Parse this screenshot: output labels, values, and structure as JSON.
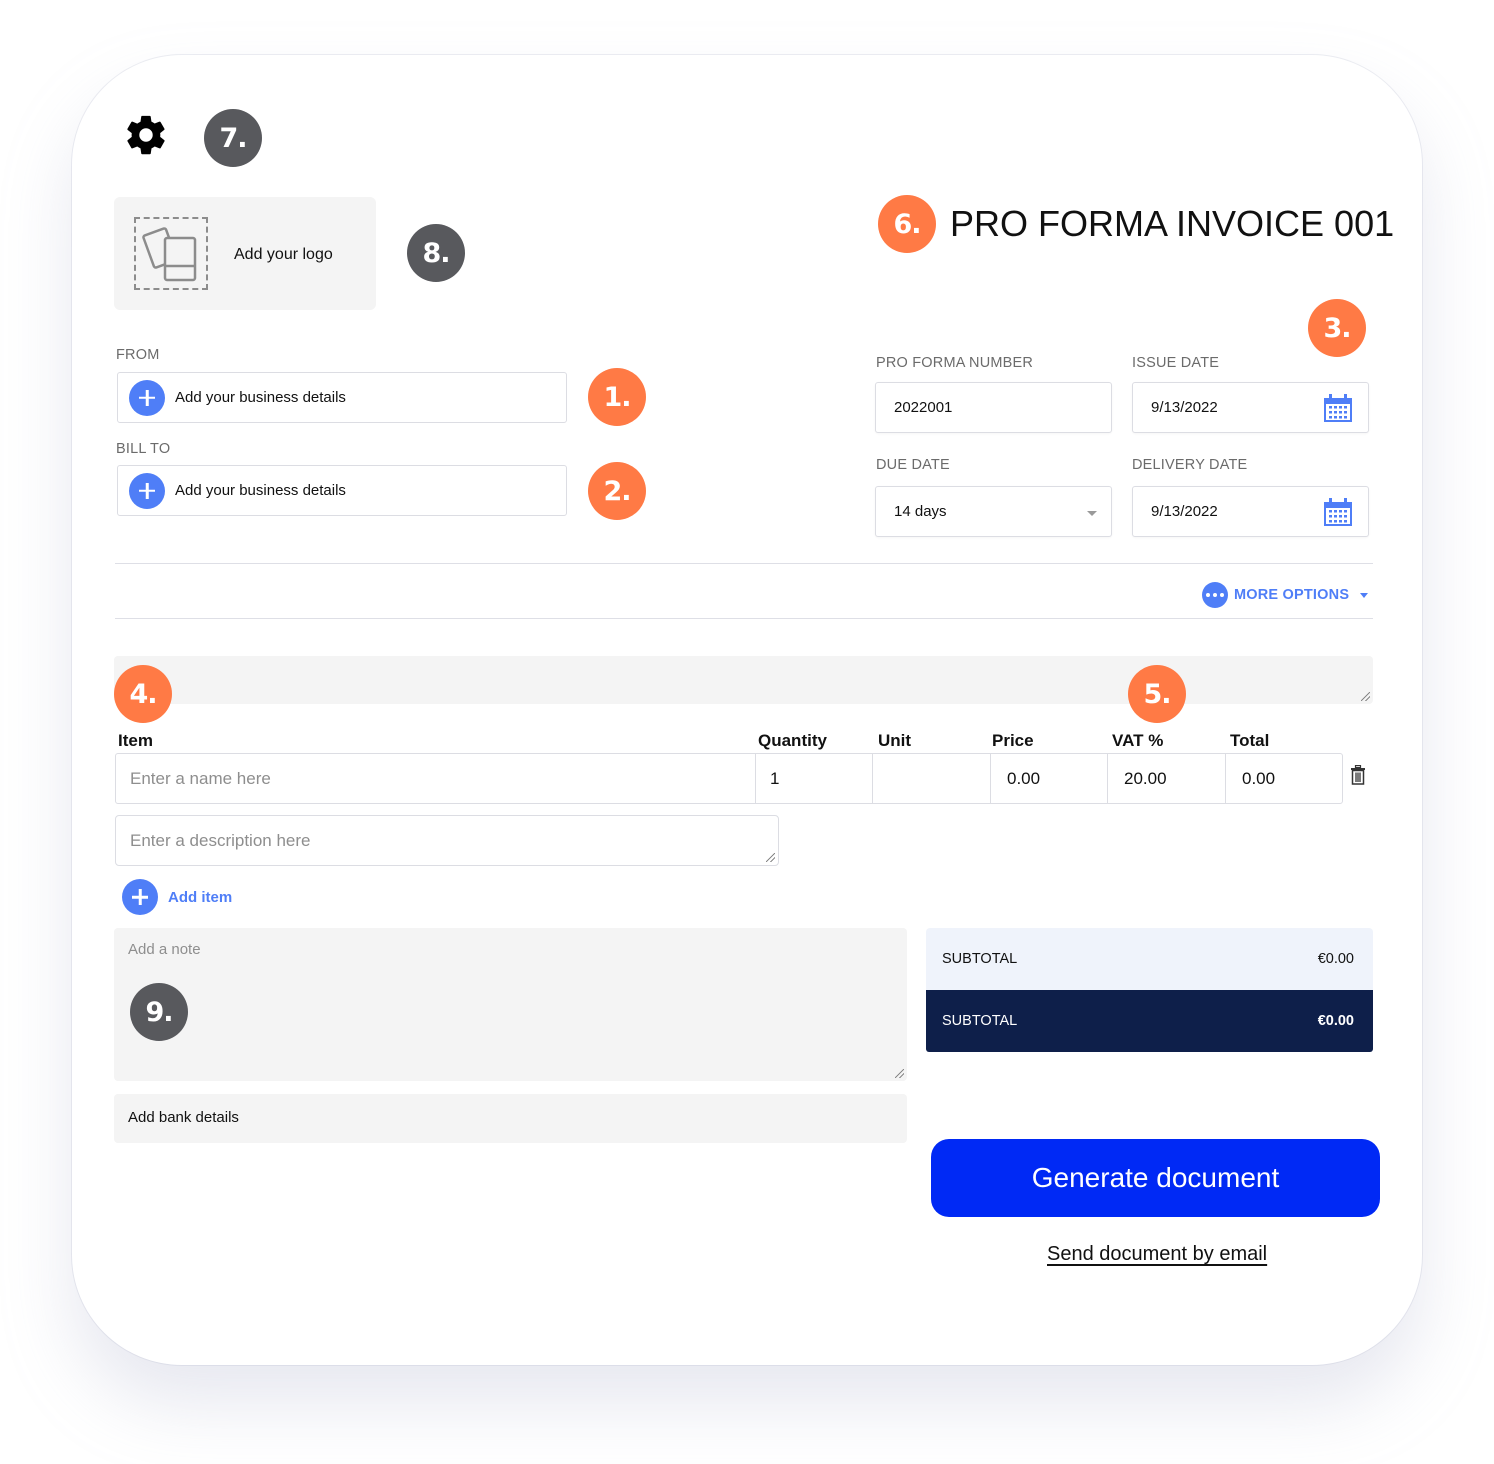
{
  "colors": {
    "accent_blue": "#4f7ef7",
    "primary_button": "#0029f5",
    "badge_orange": "#ff7a45",
    "badge_grey": "#58595d",
    "total_dark": "#0e1f4a",
    "subtotal_light": "#eff3fb"
  },
  "badges": {
    "b1": "1.",
    "b2": "2.",
    "b3": "3.",
    "b4": "4.",
    "b5": "5.",
    "b6": "6.",
    "b7": "7.",
    "b8": "8.",
    "b9": "9."
  },
  "header": {
    "settings_icon": "gear-icon",
    "logo_label": "Add your logo",
    "logo_icon": "image-placeholder-icon",
    "title": "PRO FORMA INVOICE 001"
  },
  "parties": {
    "from_label": "FROM",
    "from_button": "Add your business details",
    "bill_to_label": "BILL TO",
    "bill_to_button": "Add your business details"
  },
  "meta": {
    "number_label": "PRO FORMA NUMBER",
    "number_value": "2022001",
    "issue_date_label": "ISSUE DATE",
    "issue_date_value": "9/13/2022",
    "due_date_label": "DUE DATE",
    "due_date_value": "14 days",
    "delivery_date_label": "DELIVERY DATE",
    "delivery_date_value": "9/13/2022",
    "calendar_icon": "calendar-icon"
  },
  "more_options": {
    "label": "MORE OPTIONS"
  },
  "items": {
    "columns": [
      "Item",
      "Quantity",
      "Unit",
      "Price",
      "VAT %",
      "Total"
    ],
    "row": {
      "name_placeholder": "Enter a name here",
      "quantity": "1",
      "unit": "",
      "price": "0.00",
      "vat": "20.00",
      "total": "0.00",
      "description_placeholder": "Enter a description here"
    },
    "add_item_label": "Add item"
  },
  "notes": {
    "note_placeholder": "Add a note",
    "bank_details_label": "Add bank details"
  },
  "summary": {
    "subtotal_label": "SUBTOTAL",
    "subtotal_value": "€0.00",
    "total_label": "SUBTOTAL",
    "total_value": "€0.00"
  },
  "actions": {
    "generate_label": "Generate document",
    "email_label": "Send document by email"
  }
}
